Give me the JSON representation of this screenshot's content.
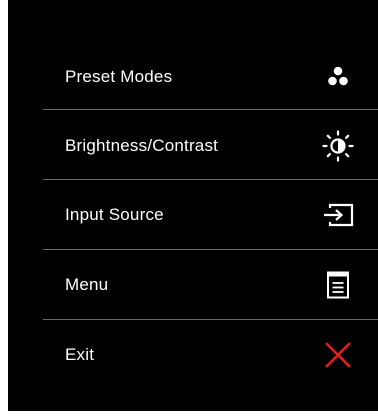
{
  "osd_menu": {
    "items": [
      {
        "label": "Preset Modes",
        "icon": "preset-modes-icon"
      },
      {
        "label": "Brightness/Contrast",
        "icon": "brightness-contrast-icon"
      },
      {
        "label": "Input Source",
        "icon": "input-source-icon"
      },
      {
        "label": "Menu",
        "icon": "menu-icon"
      },
      {
        "label": "Exit",
        "icon": "exit-icon"
      }
    ]
  },
  "colors": {
    "background": "#000000",
    "text": "#ffffff",
    "divider": "#6a6a6a",
    "exit_accent": "#e0201c"
  }
}
